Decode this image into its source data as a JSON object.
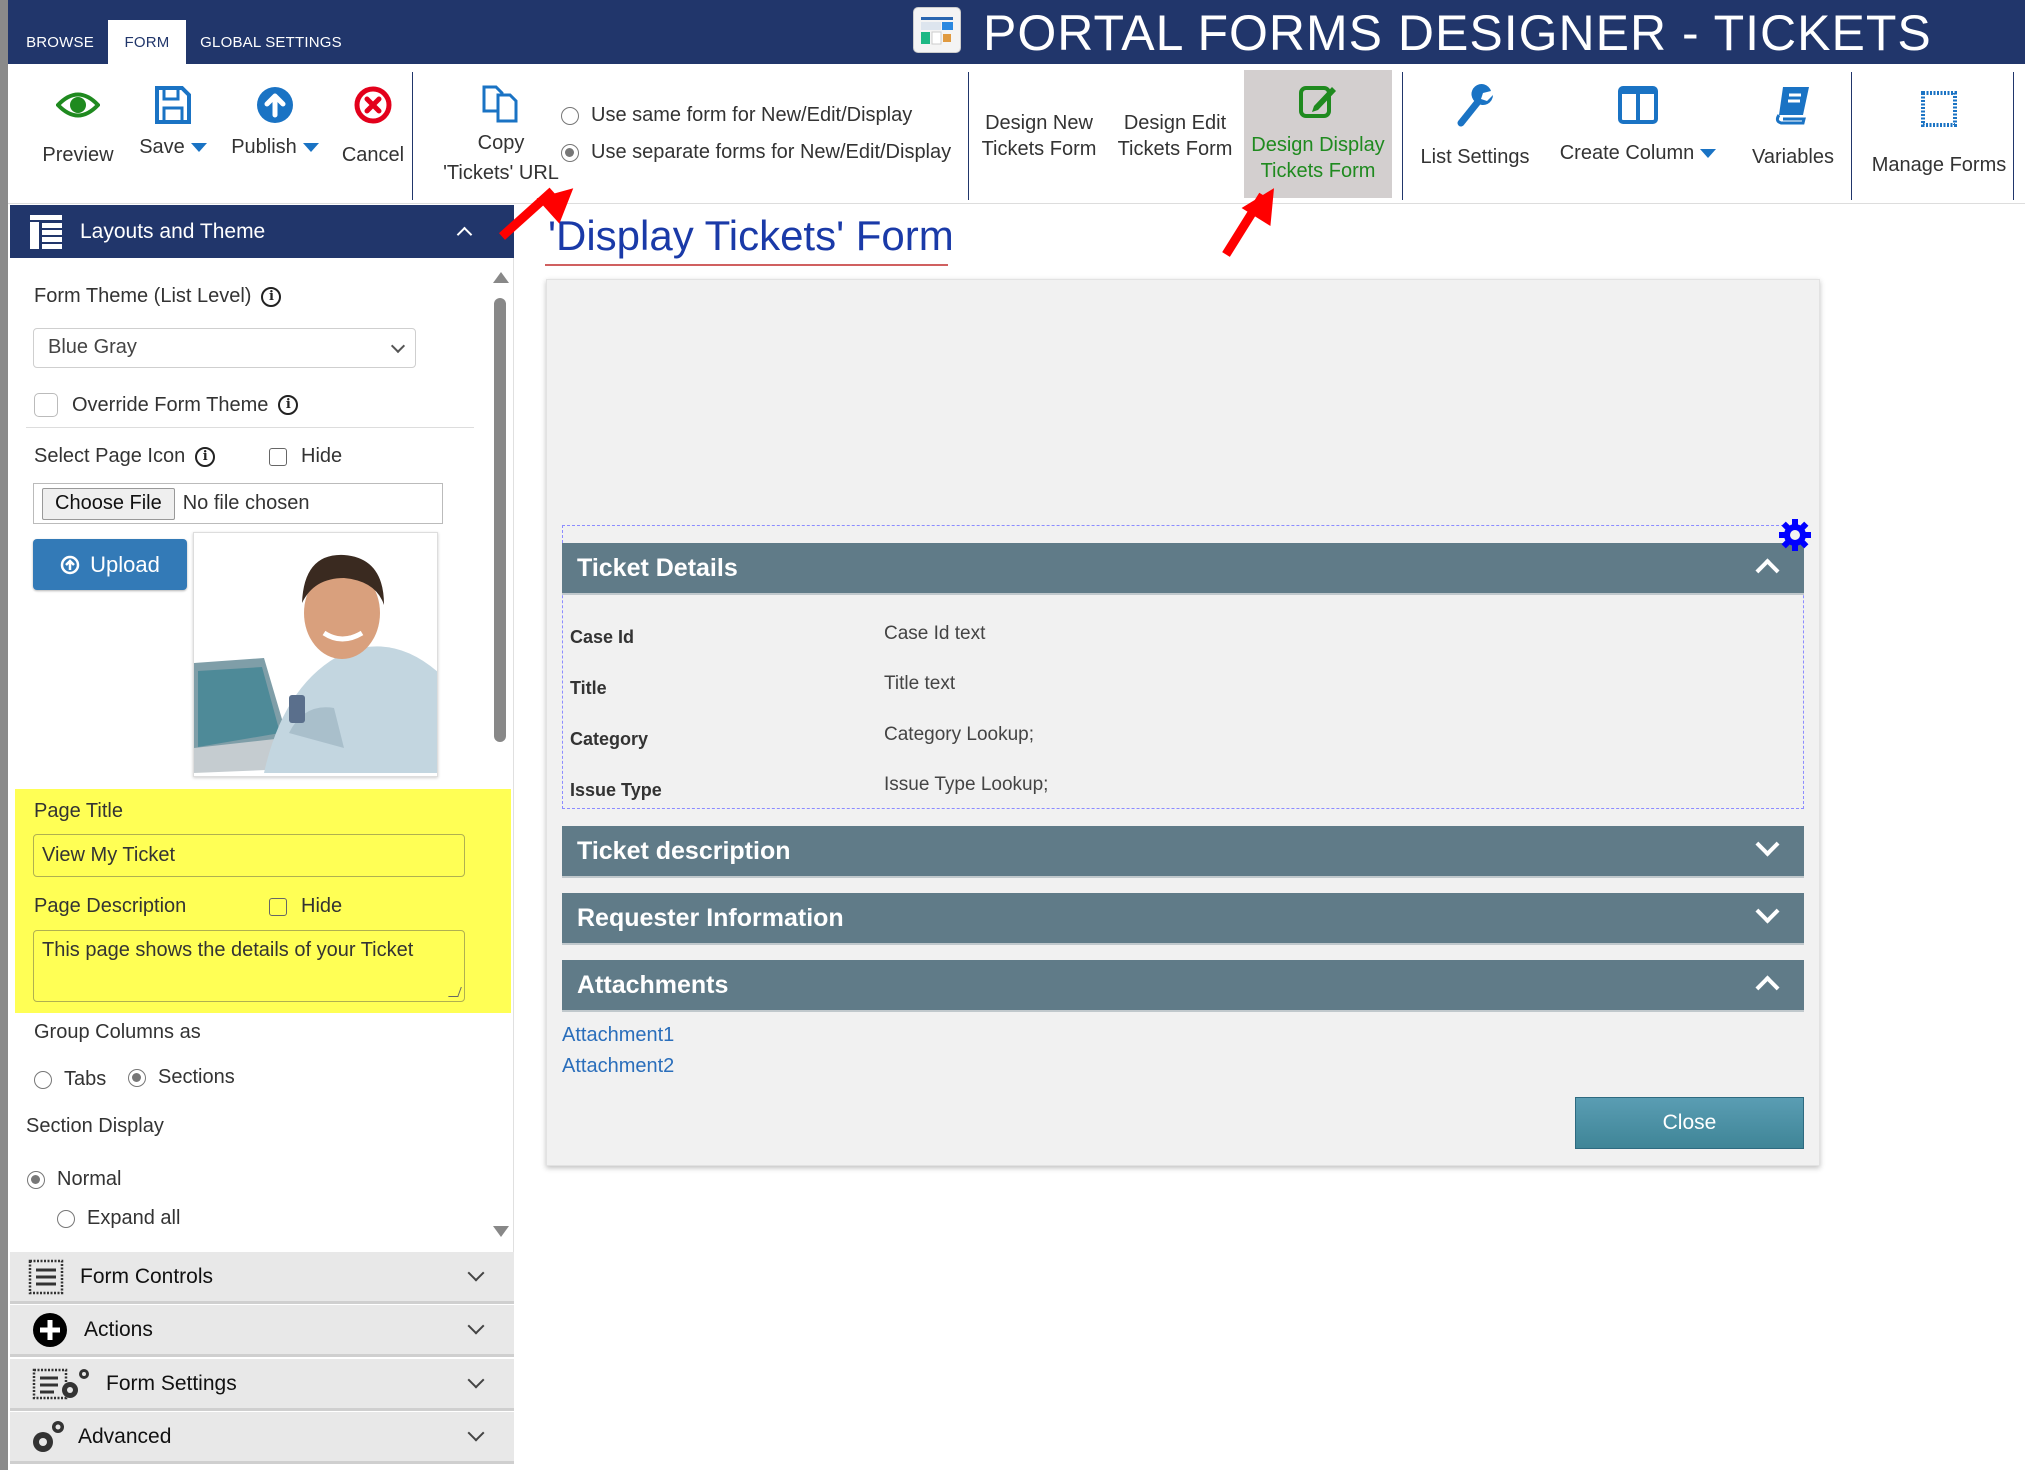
{
  "header": {
    "tabs": [
      {
        "label": "BROWSE",
        "active": false
      },
      {
        "label": "FORM",
        "active": true
      },
      {
        "label": "GLOBAL SETTINGS",
        "active": false
      }
    ],
    "app_title": "PORTAL FORMS DESIGNER - TICKETS",
    "app_icon": "forms-designer-icon"
  },
  "toolbar": {
    "preview": {
      "label": "Preview",
      "icon": "eye-icon"
    },
    "save": {
      "label": "Save",
      "icon": "floppy-disk-icon",
      "has_dropdown": true
    },
    "publish": {
      "label": "Publish",
      "icon": "upload-arrow-icon",
      "has_dropdown": true
    },
    "cancel": {
      "label": "Cancel",
      "icon": "cancel-x-icon"
    },
    "copy_url": {
      "line1": "Copy",
      "line2": "'Tickets' URL",
      "icon": "copy-icon"
    },
    "form_mode": {
      "options": [
        {
          "label": "Use same form for New/Edit/Display",
          "selected": false
        },
        {
          "label": "Use separate forms for New/Edit/Display",
          "selected": true
        }
      ]
    },
    "design_new": {
      "line1": "Design New",
      "line2": "Tickets Form"
    },
    "design_edit": {
      "line1": "Design Edit",
      "line2": "Tickets Form"
    },
    "design_display": {
      "line1": "Design Display",
      "line2": "Tickets Form",
      "icon": "edit-pencil-icon",
      "active": true
    },
    "list_settings": {
      "label": "List Settings",
      "icon": "wrench-icon"
    },
    "create_column": {
      "label": "Create Column",
      "icon": "columns-icon",
      "has_dropdown": true
    },
    "variables": {
      "label": "Variables",
      "icon": "book-icon"
    },
    "manage_forms": {
      "label": "Manage Forms",
      "icon": "dotted-square-icon"
    }
  },
  "left_panel": {
    "header": {
      "label": "Layouts and Theme",
      "expanded": true
    },
    "form_theme_label": "Form Theme (List Level)",
    "form_theme_value": "Blue Gray",
    "override_theme_label": "Override Form Theme",
    "override_theme_checked": false,
    "page_icon_label": "Select Page Icon",
    "hide_label": "Hide",
    "page_icon_hide_checked": false,
    "choose_file_label": "Choose File",
    "no_file_text": "No file chosen",
    "upload_label": "Upload",
    "page_title_label": "Page Title",
    "page_title_value": "View My Ticket",
    "page_description_label": "Page Description",
    "page_description_hide_checked": false,
    "page_description_value": "This page shows the details of your Ticket",
    "group_columns_label": "Group Columns as",
    "group_options": [
      {
        "label": "Tabs",
        "selected": false
      },
      {
        "label": "Sections",
        "selected": true
      }
    ],
    "section_display_label": "Section Display",
    "section_display_options": [
      {
        "label": "Normal",
        "selected": true
      },
      {
        "label": "Expand all",
        "selected": false
      }
    ],
    "accordions": [
      {
        "label": "Form Controls",
        "icon": "form-controls-icon"
      },
      {
        "label": "Actions",
        "icon": "plus-circle-icon"
      },
      {
        "label": "Form Settings",
        "icon": "form-settings-icon"
      },
      {
        "label": "Advanced",
        "icon": "gears-icon"
      }
    ]
  },
  "main": {
    "title": "'Display Tickets' Form",
    "sections": [
      {
        "title": "Ticket Details",
        "expanded": true,
        "fields": [
          {
            "label": "Case Id",
            "value": "Case Id text"
          },
          {
            "label": "Title",
            "value": "Title text"
          },
          {
            "label": "Category",
            "value": "Category Lookup;"
          },
          {
            "label": "Issue Type",
            "value": "Issue Type Lookup;"
          }
        ]
      },
      {
        "title": "Ticket description",
        "expanded": false
      },
      {
        "title": "Requester Information",
        "expanded": false
      },
      {
        "title": "Attachments",
        "expanded": true,
        "links": [
          "Attachment1",
          "Attachment2"
        ]
      }
    ],
    "close_label": "Close"
  },
  "colors": {
    "brand_dark": "#21366b",
    "section_header": "#607b88",
    "highlight_yellow": "#ffff55",
    "annotation_red": "#ff0000",
    "title_blue": "#1a3aa8",
    "active_green": "#1f8a1f"
  }
}
